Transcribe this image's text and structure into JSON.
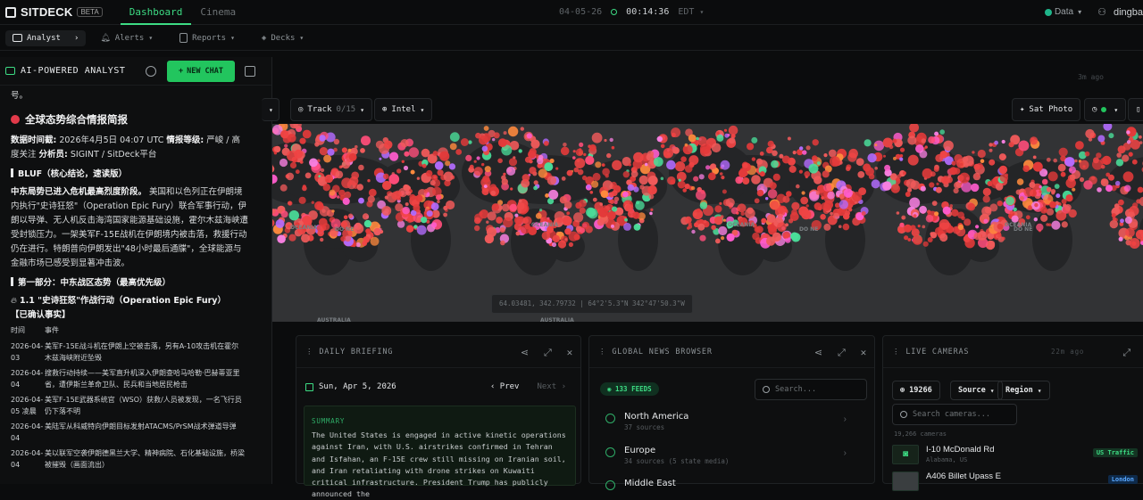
{
  "app": {
    "name": "SITDECK",
    "badge": "BETA"
  },
  "top_tabs": [
    {
      "label": "Dashboard",
      "active": true
    },
    {
      "label": "Cinema",
      "active": false
    }
  ],
  "clock": {
    "date": "04-05-26",
    "time": "00:14:36",
    "tz": "EDT"
  },
  "top_right": {
    "data_label": "Data",
    "user": "dingba"
  },
  "subnav": [
    {
      "label": "Analyst",
      "icon": "chat-icon"
    },
    {
      "label": "Alerts",
      "icon": "bell-icon"
    },
    {
      "label": "Reports",
      "icon": "report-icon"
    },
    {
      "label": "Decks",
      "icon": "layers-icon"
    }
  ],
  "sidebar": {
    "title": "AI-POWERED ANALYST",
    "new_chat_label": "NEW CHAT",
    "chat": {
      "fragment": "号。",
      "heading": "全球态势综合情报简报",
      "meta_time_label": "数据时间截:",
      "meta_time_value": "2026年4月5日 04:07 UTC",
      "meta_level_label": "情报等级:",
      "meta_level_value": "严峻 / 高度关注",
      "meta_analyst_label": "分析员:",
      "meta_analyst_value": "SIGINT / SitDeck平台",
      "bluf_heading": "BLUF（核心结论，速读版）",
      "bluf_lead": "中东局势已进入危机最高烈度阶段。",
      "bluf_body": "美国和以色列正在伊朗境内执行\"史诗狂怒\"（Operation Epic Fury）联合军事行动，伊朗以导弹、无人机反击海湾国家能源基础设施，霍尔木兹海峡遭受封锁压力。一架美军F-15E战机在伊朗境内被击落，救援行动仍在进行。特朗普向伊朗发出\"48小时最后通牒\"，全球能源与金融市场已感受到显著冲击波。",
      "part1_heading": "第一部分：中东战区态势（最高优先级）",
      "sub_heading": "1.1 \"史诗狂怒\"作战行动（Operation Epic Fury）",
      "confirmed": "【已确认事实】",
      "table_header": [
        "时间",
        "事件"
      ],
      "events": [
        {
          "time": "2026-04-03",
          "text": "美军F-15E战斗机在伊朗上空被击落，另有A-10攻击机在霍尔木兹海峡附近坠毁"
        },
        {
          "time": "2026-04-04",
          "text": "搜救行动持续——美军直升机深入伊朗查哈马哈勒·巴赫蒂亚里省，遭伊斯兰革命卫队、民兵和当地居民枪击"
        },
        {
          "time": "2026-04-05 凌晨",
          "text": "美军F-15E武器系统官（WSO）获救/人员被发现，一名飞行员仍下落不明"
        },
        {
          "time": "2026-04-04",
          "text": "美陆军从科威特向伊朗目标发射ATACMS/PrSM战术弹道导弹"
        },
        {
          "time": "2026-04-04",
          "text": "美以联军空袭伊朗德黑兰大学、精神病院、石化基础设施，桥梁被摧毁（画面流出）"
        }
      ]
    }
  },
  "main": {
    "sync_label": "3m ago"
  },
  "toolbar": {
    "track_label": "Track",
    "track_count": "0/15",
    "intel_label": "Intel",
    "sat_photo_label": "Sat Photo"
  },
  "map": {
    "coord_readout": "64.03481, 342.79732 | 64°2'5.3\"N 342°47'50.3\"W",
    "labels": [
      "OCEANIA",
      "DO NE",
      "AUSTRALIA"
    ]
  },
  "panels": {
    "daily_briefing": {
      "title": "DAILY BRIEFING",
      "date": "Sun, Apr 5, 2026",
      "prev": "Prev",
      "next": "Next",
      "summary_label": "SUMMARY",
      "summary": "The United States is engaged in active kinetic operations against Iran, with U.S. airstrikes confirmed in Tehran and Isfahan, an F-15E crew still missing on Iranian soil, and Iran retaliating with drone strikes on Kuwaiti critical infrastructure. President Trump has publicly announced the"
    },
    "global_news": {
      "title": "GLOBAL NEWS BROWSER",
      "feeds_badge": "133 FEEDS",
      "search_placeholder": "Search...",
      "regions": [
        {
          "name": "North America",
          "count": "37 sources"
        },
        {
          "name": "Europe",
          "count": "34 sources (5 state media)"
        },
        {
          "name": "Middle East",
          "count": ""
        }
      ]
    },
    "live_cameras": {
      "title": "LIVE CAMERAS",
      "sync": "22m ago",
      "count_pill": "19266",
      "source_label": "Source",
      "region_label": "Region",
      "search_placeholder": "Search cameras...",
      "total": "19,266 cameras",
      "cameras": [
        {
          "name": "I-10 McDonald Rd",
          "location": "Alabama, US",
          "badge": "US Traffic"
        },
        {
          "name": "A406 Billet Upass E",
          "location": "",
          "badge": "London"
        }
      ]
    }
  },
  "colors": {
    "accent": "#22c55e",
    "hotspot": "#e23a4a",
    "map_bg": "#323335"
  }
}
